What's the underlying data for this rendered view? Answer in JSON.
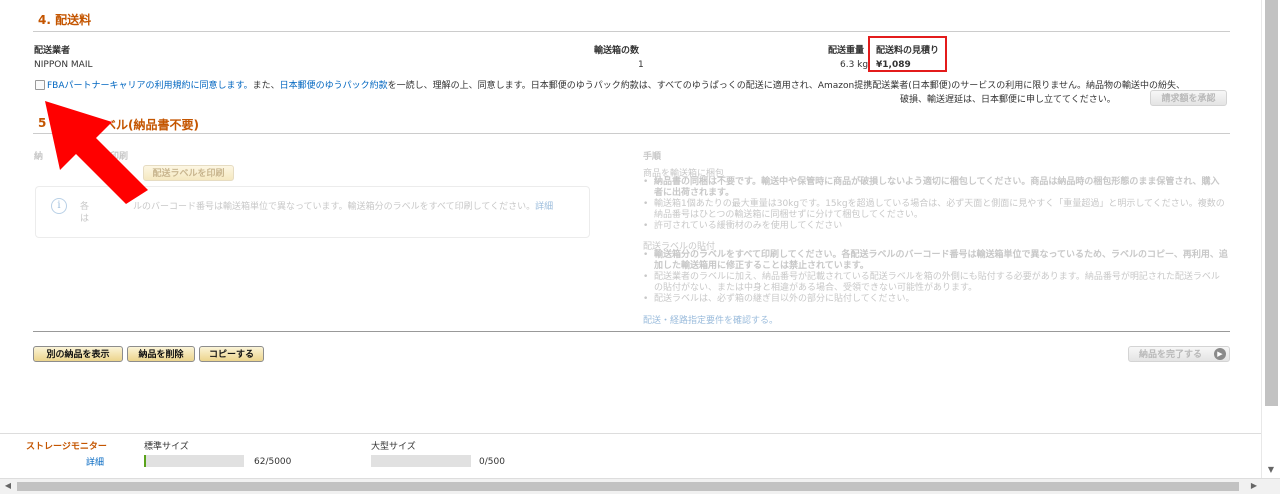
{
  "section4": {
    "title": "4. 配送料",
    "headers": {
      "carrier": "配送業者",
      "boxes": "輸送箱の数",
      "weight": "配送重量",
      "estimate": "配送料の見積り"
    },
    "row": {
      "carrier": "NIPPON MAIL",
      "boxes": "1",
      "weight": "6.3 kg",
      "estimate": "¥1,089"
    },
    "agreement": {
      "link1": "FBAパートナーキャリアの利用規約に同意します。",
      "text1": "また、",
      "link2": "日本郵便のゆうパック約款",
      "text2": "を一読し、理解の上、同意します。日本郵便のゆうパック約款は、すべてのゆうぱっくの配送に適用され、Amazon提携配送業者(日本郵便)のサービスの利用に限りません。納品物の輸送中の紛失、",
      "text3": "破損、輸送遅延は、日本郵便に申し立ててください。",
      "button": "請求額を承認"
    }
  },
  "section5": {
    "title_prefix": "5",
    "title_rest": "ベル(納品書不要)",
    "left_label_a": "納",
    "left_label_b": "印刷",
    "print_button": "配送ラベルを印刷",
    "info_a": "各",
    "info_text": "ルのバーコード番号は輸送箱単位で異なっています。輸送箱分のラベルをすべて印刷してください。",
    "info_link": "詳細",
    "info_b": "は",
    "procedure_title": "手順",
    "pack_title": "商品を輸送箱に梱包",
    "pack_items": [
      "納品書の同梱は不要です。輸送中や保管時に商品が破損しないよう適切に梱包してください。商品は納品時の梱包形態のまま保管され、購入者に出荷されます。",
      "輸送箱1個あたりの最大重量は30kgです。15kgを超過している場合は、必ず天面と側面に見やすく「重量超過」と明示してください。複数の納品番号はひとつの輸送箱に同梱せずに分けて梱包してください。",
      "許可されている緩衝材のみを使用してください"
    ],
    "label_title": "配送ラベルの貼付",
    "label_items": [
      "輸送箱分のラベルをすべて印刷してください。各配送ラベルのバーコード番号は輸送箱単位で異なっているため、ラベルのコピー、再利用、追加した輸送箱用に修正することは禁止されています。",
      "配送業者のラベルに加え、納品番号が記載されている配送ラベルを箱の外側にも貼付する必要があります。納品番号が明記された配送ラベルの貼付がない、または中身と相違がある場合、受領できない可能性があります。",
      "配送ラベルは、必ず箱の継ぎ目以外の部分に貼付してください。"
    ],
    "requirements_link": "配送・経路指定要件を確認する。"
  },
  "footer_buttons": {
    "view_other": "別の納品を表示",
    "delete": "納品を削除",
    "copy": "コピーする",
    "complete": "納品を完了する"
  },
  "storage": {
    "title": "ストレージモニター",
    "detail": "詳細",
    "standard_label": "標準サイズ",
    "standard_value": "62/5000",
    "standard_fraction": 0.0124,
    "large_label": "大型サイズ",
    "large_value": "0/500",
    "large_fraction": 0
  },
  "colors": {
    "accent": "#c45500",
    "link": "#0066c0",
    "arrow": "#ff0000",
    "highlight_box": "#e31b1b"
  }
}
